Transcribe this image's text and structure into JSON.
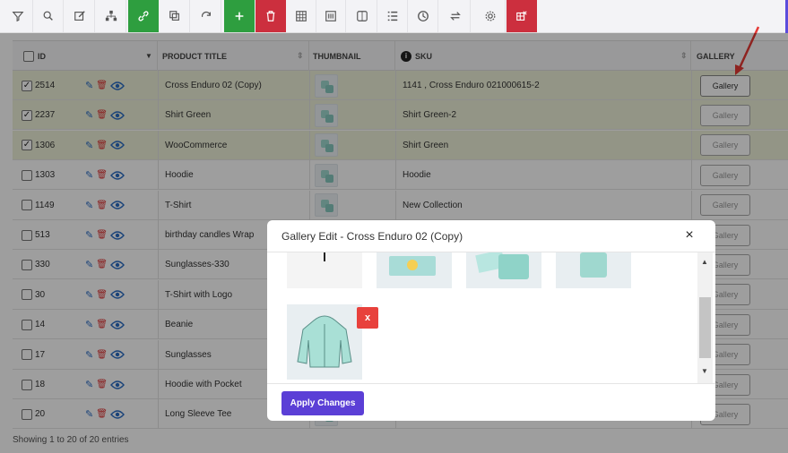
{
  "toolbar": {
    "buttons": [
      "filter-icon",
      "search-icon",
      "edit-icon",
      "hierarchy-icon",
      "link-icon",
      "copy-icon",
      "refresh-icon",
      "plus-icon",
      "trash-icon",
      "table-icon",
      "barcode-icon",
      "columns-icon",
      "list-icon",
      "clock-icon",
      "sync-icon",
      "gear-icon",
      "grid-delete-icon"
    ]
  },
  "table": {
    "headers": {
      "id": "ID",
      "title": "PRODUCT TITLE",
      "thumbnail": "THUMBNAIL",
      "sku": "SKU",
      "gallery": "GALLERY"
    },
    "gallery_label": "Gallery",
    "rows": [
      {
        "id": "2514",
        "title": "Cross Enduro 02 (Copy)",
        "sku": "1141 , Cross Enduro 021000615-2",
        "checked": "✓"
      },
      {
        "id": "2237",
        "title": "Shirt Green",
        "sku": "Shirt Green-2",
        "checked": "✓"
      },
      {
        "id": "1306",
        "title": "WooCommerce",
        "sku": "Shirt Green",
        "checked": "✓"
      },
      {
        "id": "1303",
        "title": "Hoodie",
        "sku": "Hoodie",
        "checked": ""
      },
      {
        "id": "1149",
        "title": "T-Shirt",
        "sku": "New Collection",
        "checked": ""
      },
      {
        "id": "513",
        "title": "birthday candles Wrap",
        "sku": "",
        "checked": ""
      },
      {
        "id": "330",
        "title": "Sunglasses-330",
        "sku": "",
        "checked": ""
      },
      {
        "id": "30",
        "title": "T-Shirt with Logo",
        "sku": "",
        "checked": ""
      },
      {
        "id": "14",
        "title": "Beanie",
        "sku": "",
        "checked": ""
      },
      {
        "id": "17",
        "title": "Sunglasses",
        "sku": "",
        "checked": ""
      },
      {
        "id": "18",
        "title": "Hoodie with Pocket",
        "sku": "",
        "checked": ""
      },
      {
        "id": "20",
        "title": "Long Sleeve Tee",
        "sku": "",
        "checked": ""
      }
    ]
  },
  "footer": {
    "text": "Showing 1 to 20 of 20 entries"
  },
  "modal": {
    "title": "Gallery Edit - Cross Enduro 02 (Copy)",
    "close": "×",
    "remove_label": "x",
    "apply_label": "Apply Changes"
  },
  "colors": {
    "accent": "#5b3fd6",
    "green": "#2e9e3f",
    "red": "#cc2f3e",
    "selected_row": "#eef1d9",
    "annotation_arrow": "#e53935"
  }
}
